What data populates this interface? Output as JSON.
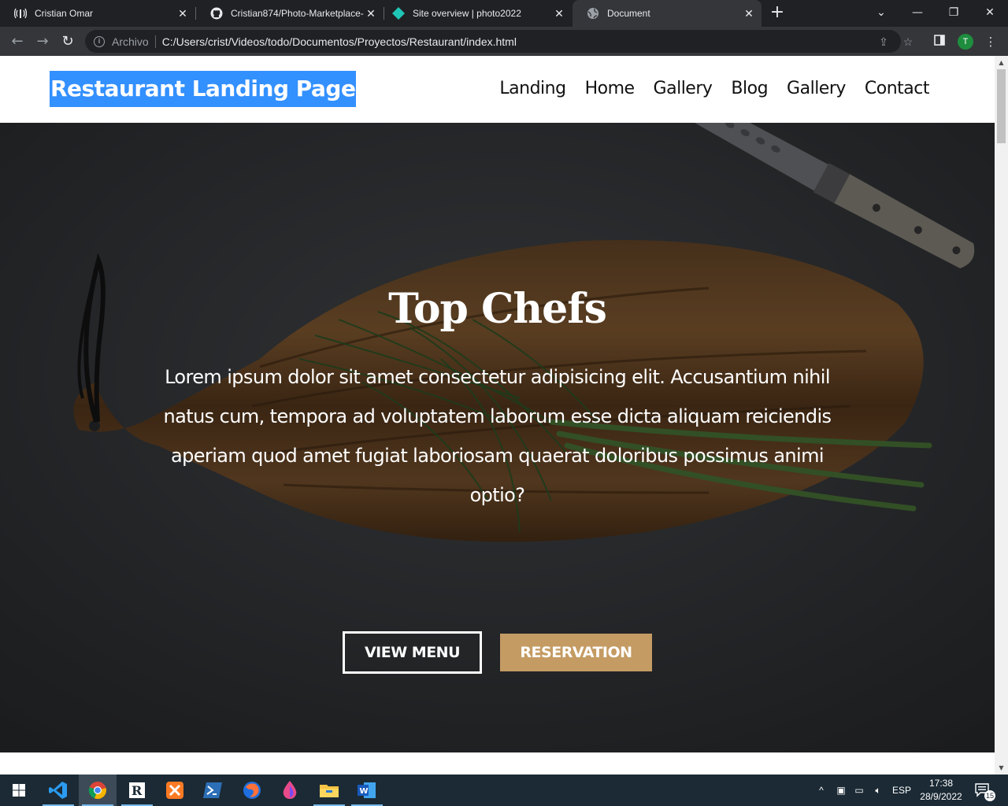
{
  "browser": {
    "tabs": [
      {
        "title": "Cristian Omar",
        "icon": "radio-waves-icon"
      },
      {
        "title": "Cristian874/Photo-Marketplace-",
        "icon": "github-icon"
      },
      {
        "title": "Site overview | photo2022",
        "icon": "netlify-icon"
      },
      {
        "title": "Document",
        "icon": "globe-icon",
        "active": true
      }
    ],
    "omnibox": {
      "scheme_label": "Archivo",
      "url": "C:/Users/crist/Videos/todo/Documentos/Proyectos/Restaurant/index.html"
    },
    "profile_initial": "T"
  },
  "site": {
    "brand": "Restaurant Landing Page",
    "nav": [
      "Landing",
      "Home",
      "Gallery",
      "Blog",
      "Gallery",
      "Contact"
    ],
    "hero": {
      "title": "Top Chefs",
      "text": "Lorem ipsum dolor sit amet consectetur adipisicing elit. Accusantium nihil natus cum, tempora ad voluptatem laborum esse dicta aliquam reiciendis aperiam quod amet fugiat laboriosam quaerat doloribus possimus animi optio?",
      "primary_button": "VIEW MENU",
      "secondary_button": "RESERVATION"
    },
    "colors": {
      "brand_highlight": "#3390ff",
      "accent": "#c49b63"
    }
  },
  "taskbar": {
    "language": "ESP",
    "time": "17:38",
    "date": "28/9/2022",
    "notification_count": "15"
  }
}
